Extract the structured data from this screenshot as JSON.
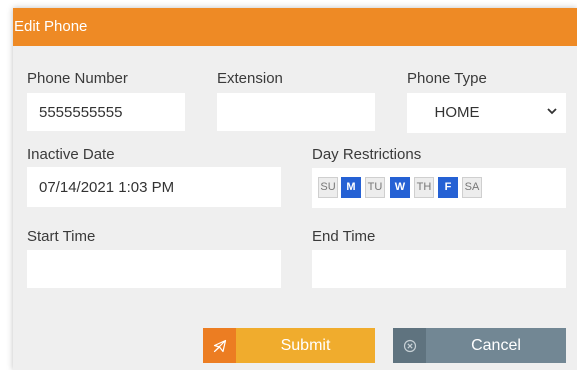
{
  "dialog": {
    "title": "Edit Phone"
  },
  "form": {
    "phone_number": {
      "label": "Phone Number",
      "value": "5555555555"
    },
    "extension": {
      "label": "Extension",
      "value": ""
    },
    "phone_type": {
      "label": "Phone Type",
      "value": "HOME"
    },
    "inactive_date": {
      "label": "Inactive Date",
      "value": "07/14/2021 1:03 PM"
    },
    "day_restrictions": {
      "label": "Day Restrictions",
      "days": [
        {
          "label": "SU",
          "selected": false
        },
        {
          "label": "M",
          "selected": true
        },
        {
          "label": "TU",
          "selected": false
        },
        {
          "label": "W",
          "selected": true
        },
        {
          "label": "TH",
          "selected": false
        },
        {
          "label": "F",
          "selected": true
        },
        {
          "label": "SA",
          "selected": false
        }
      ]
    },
    "start_time": {
      "label": "Start Time",
      "value": ""
    },
    "end_time": {
      "label": "End Time",
      "value": ""
    }
  },
  "buttons": {
    "submit": {
      "label": "Submit",
      "icon": "paper-plane-icon"
    },
    "cancel": {
      "label": "Cancel",
      "icon": "close-circle-icon"
    }
  },
  "colors": {
    "accent": "#ee8a25",
    "submit": "#f0ac2d",
    "submit_icon_bg": "#ec7d22",
    "cancel": "#728794",
    "cancel_icon_bg": "#5f737f",
    "day_selected": "#2561d4"
  }
}
